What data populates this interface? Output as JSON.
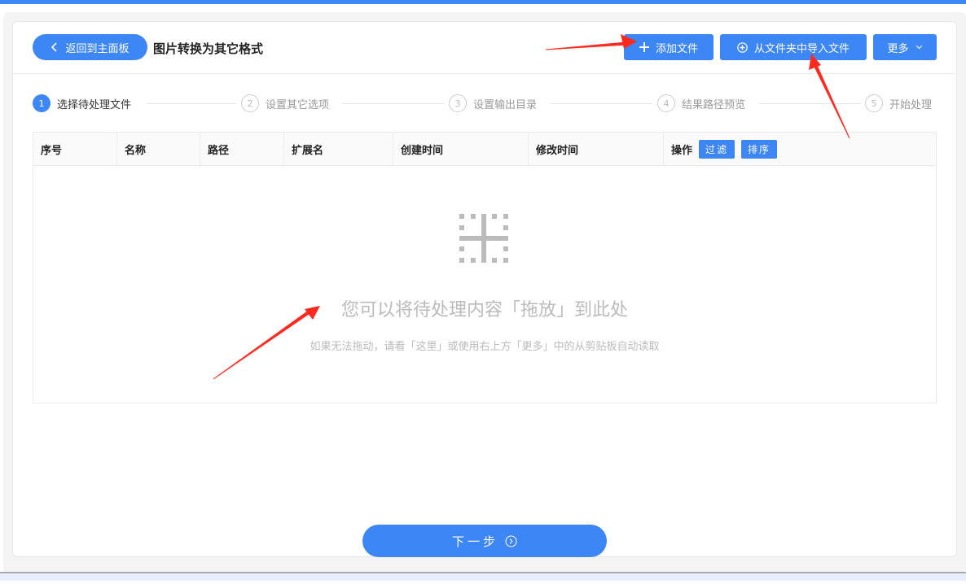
{
  "header": {
    "back_label": "返回到主面板",
    "title": "图片转换为其它格式",
    "add_file": "添加文件",
    "import_folder": "从文件夹中导入文件",
    "more": "更多"
  },
  "steps": [
    {
      "n": "1",
      "label": "选择待处理文件",
      "active": true
    },
    {
      "n": "2",
      "label": "设置其它选项"
    },
    {
      "n": "3",
      "label": "设置输出目录"
    },
    {
      "n": "4",
      "label": "结果路径预览"
    },
    {
      "n": "5",
      "label": "开始处理"
    }
  ],
  "table": {
    "columns": [
      "序号",
      "名称",
      "路径",
      "扩展名",
      "创建时间",
      "修改时间",
      "操作"
    ],
    "filter": "过滤",
    "sort": "排序"
  },
  "empty": {
    "title": "您可以将待处理内容「拖放」到此处",
    "hint": "如果无法拖动，请看「这里」或使用右上方「更多」中的从剪贴板自动读取"
  },
  "footer": {
    "next": "下一步"
  },
  "colors": {
    "accent": "#3d86f5",
    "annotation": "#ff2a1f"
  }
}
